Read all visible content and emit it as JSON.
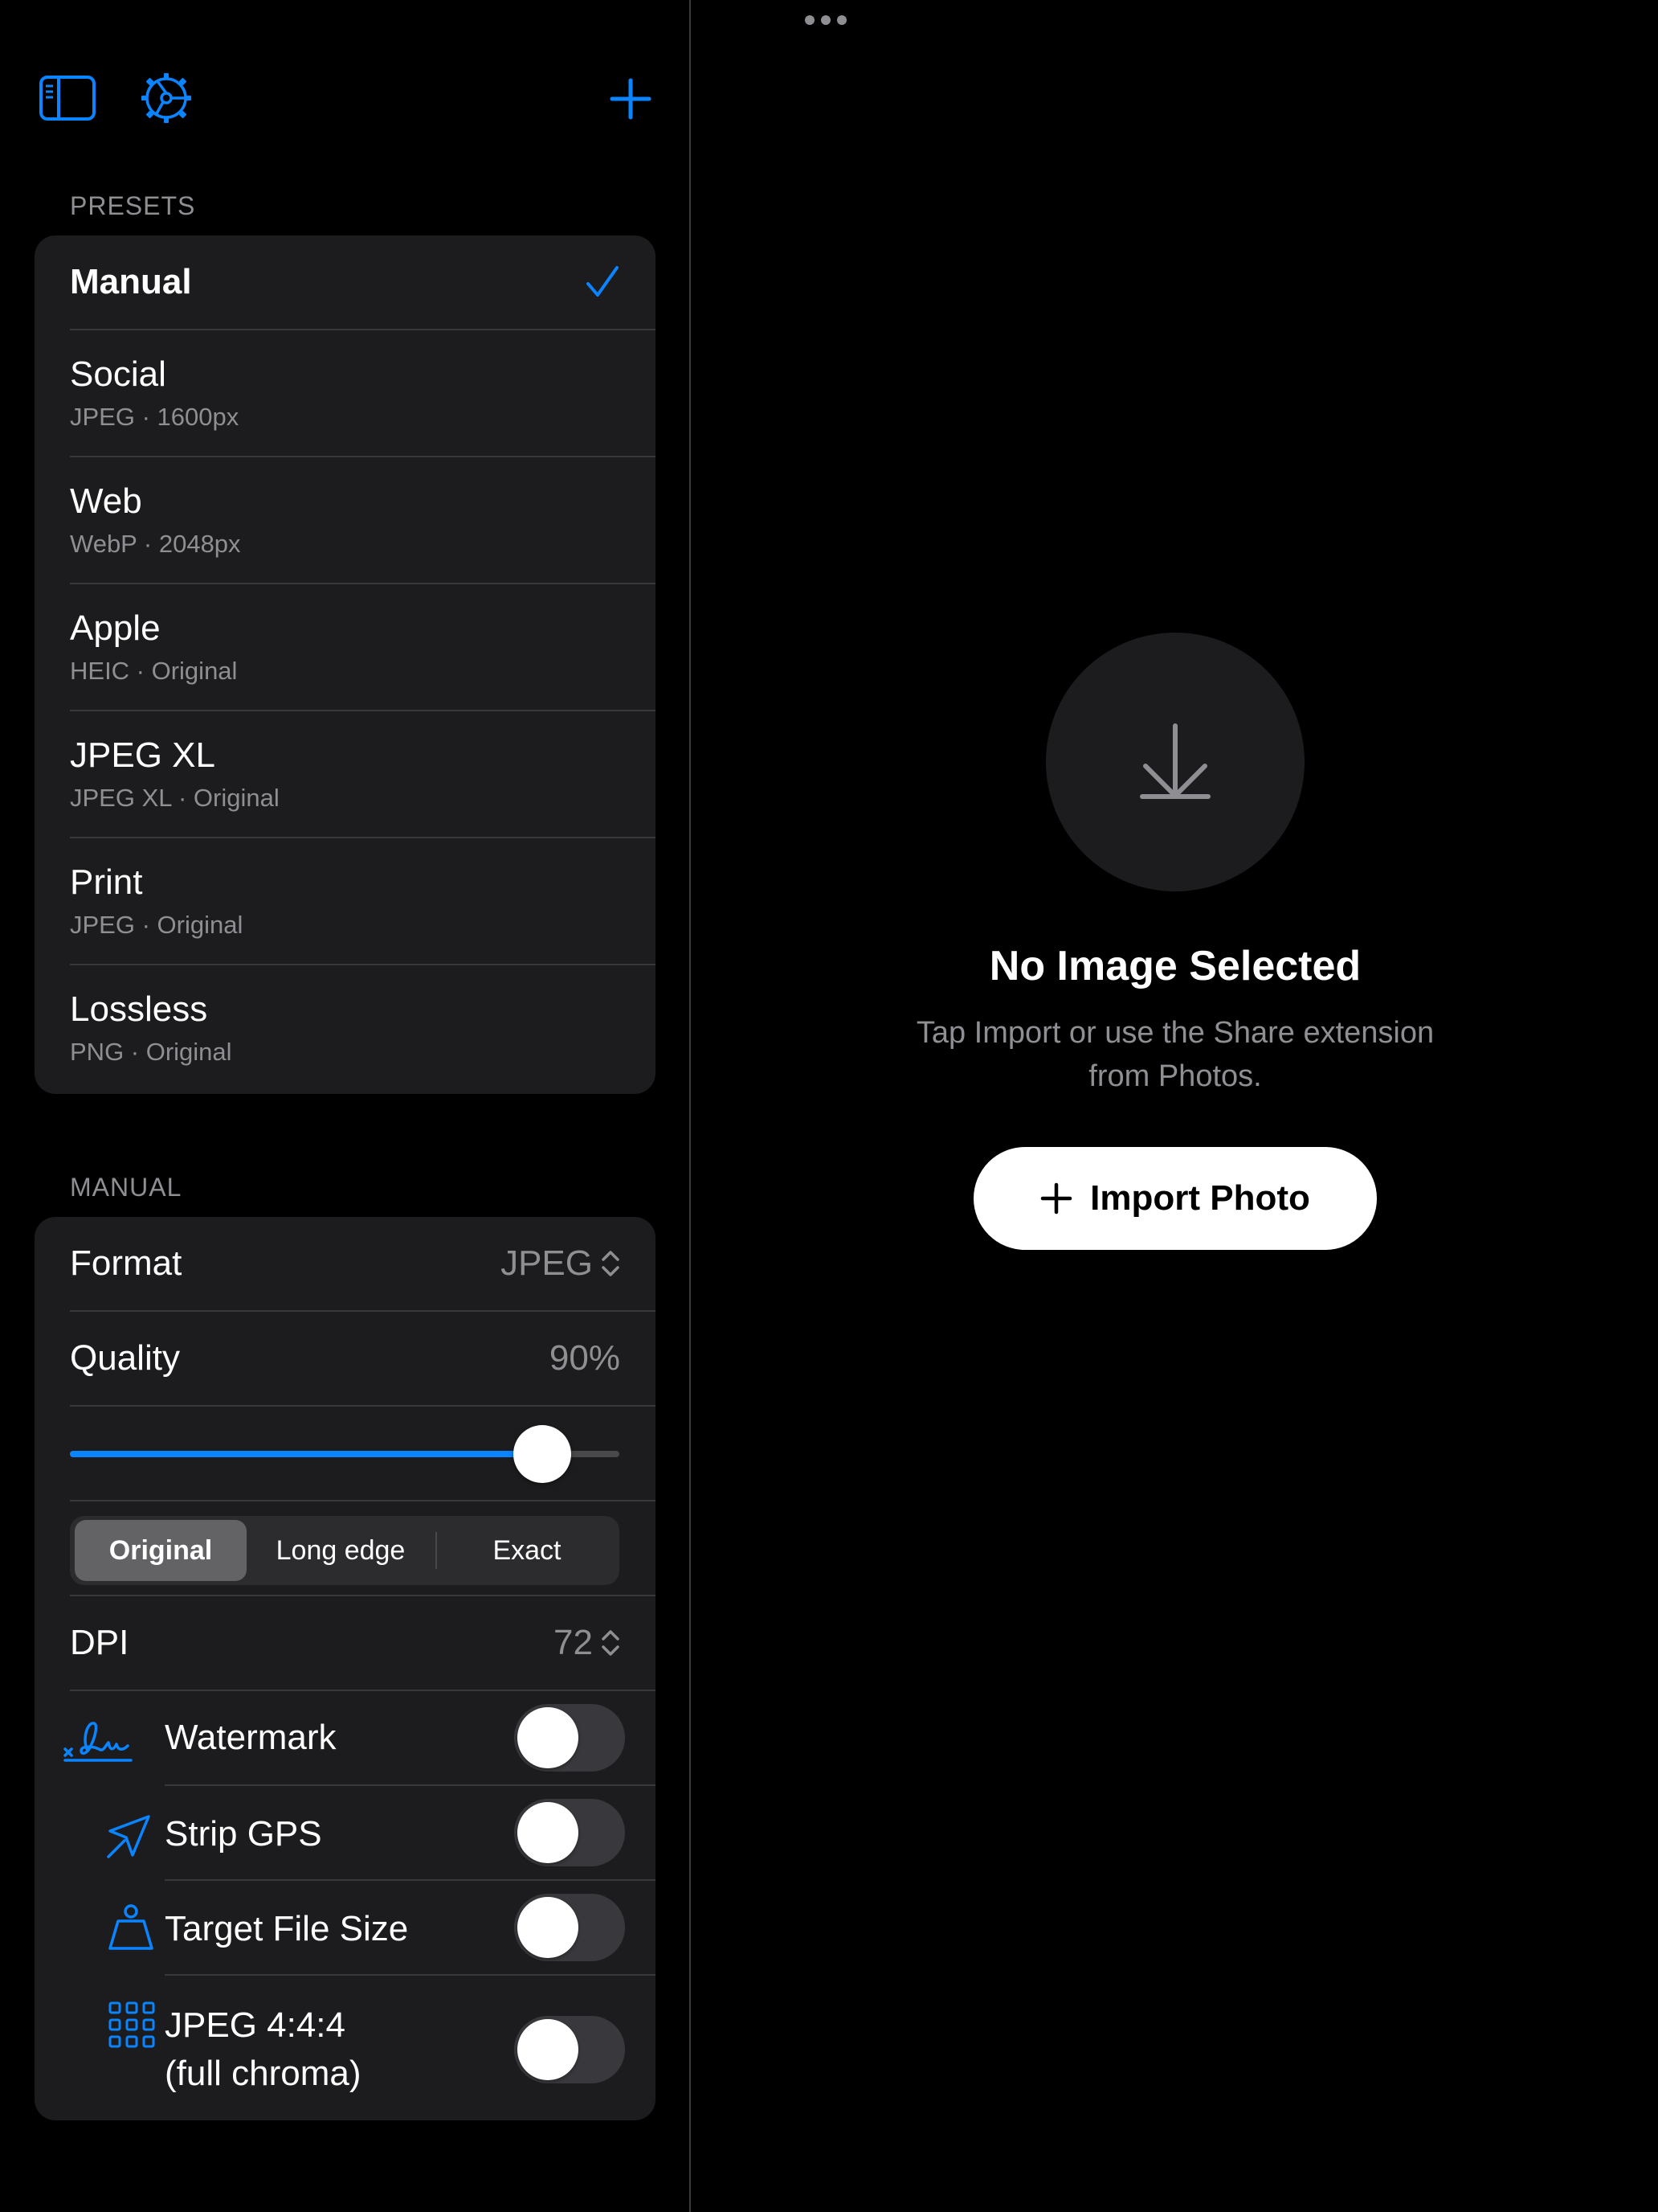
{
  "colors": {
    "accent": "#0a84ff",
    "background": "#000000",
    "card": "#1c1c1e",
    "secondary_text": "#8e8e93"
  },
  "toolbar": {
    "sidebar_icon": "sidebar-icon",
    "settings_icon": "gear-icon",
    "add_icon": "plus-icon"
  },
  "presets": {
    "section_label": "PRESETS",
    "items": [
      {
        "title": "Manual",
        "subtitle": "",
        "selected": true
      },
      {
        "title": "Social",
        "subtitle": "JPEG · 1600px",
        "selected": false
      },
      {
        "title": "Web",
        "subtitle": "WebP · 2048px",
        "selected": false
      },
      {
        "title": "Apple",
        "subtitle": "HEIC · Original",
        "selected": false
      },
      {
        "title": "JPEG XL",
        "subtitle": "JPEG XL · Original",
        "selected": false
      },
      {
        "title": "Print",
        "subtitle": "JPEG · Original",
        "selected": false
      },
      {
        "title": "Lossless",
        "subtitle": "PNG · Original",
        "selected": false
      }
    ]
  },
  "manual": {
    "section_label": "MANUAL",
    "format": {
      "label": "Format",
      "value": "JPEG"
    },
    "quality": {
      "label": "Quality",
      "value": "90%",
      "fraction": 0.86
    },
    "resize_modes": {
      "options": [
        "Original",
        "Long edge",
        "Exact"
      ],
      "selected": "Original"
    },
    "dpi": {
      "label": "DPI",
      "value": "72"
    },
    "toggles": [
      {
        "label": "Watermark",
        "icon": "signature-icon",
        "on": false
      },
      {
        "label": "Strip GPS",
        "icon": "location-slash-icon",
        "on": false
      },
      {
        "label": "Target File Size",
        "icon": "scale-weight-icon",
        "on": false
      },
      {
        "label": "JPEG 4:4:4\n(full chroma)",
        "icon": "grid-icon",
        "on": false
      }
    ]
  },
  "empty_state": {
    "icon": "download-icon",
    "title": "No Image Selected",
    "subtitle_line1": "Tap Import or use the Share extension",
    "subtitle_line2": "from Photos.",
    "import_label": "Import Photo"
  }
}
